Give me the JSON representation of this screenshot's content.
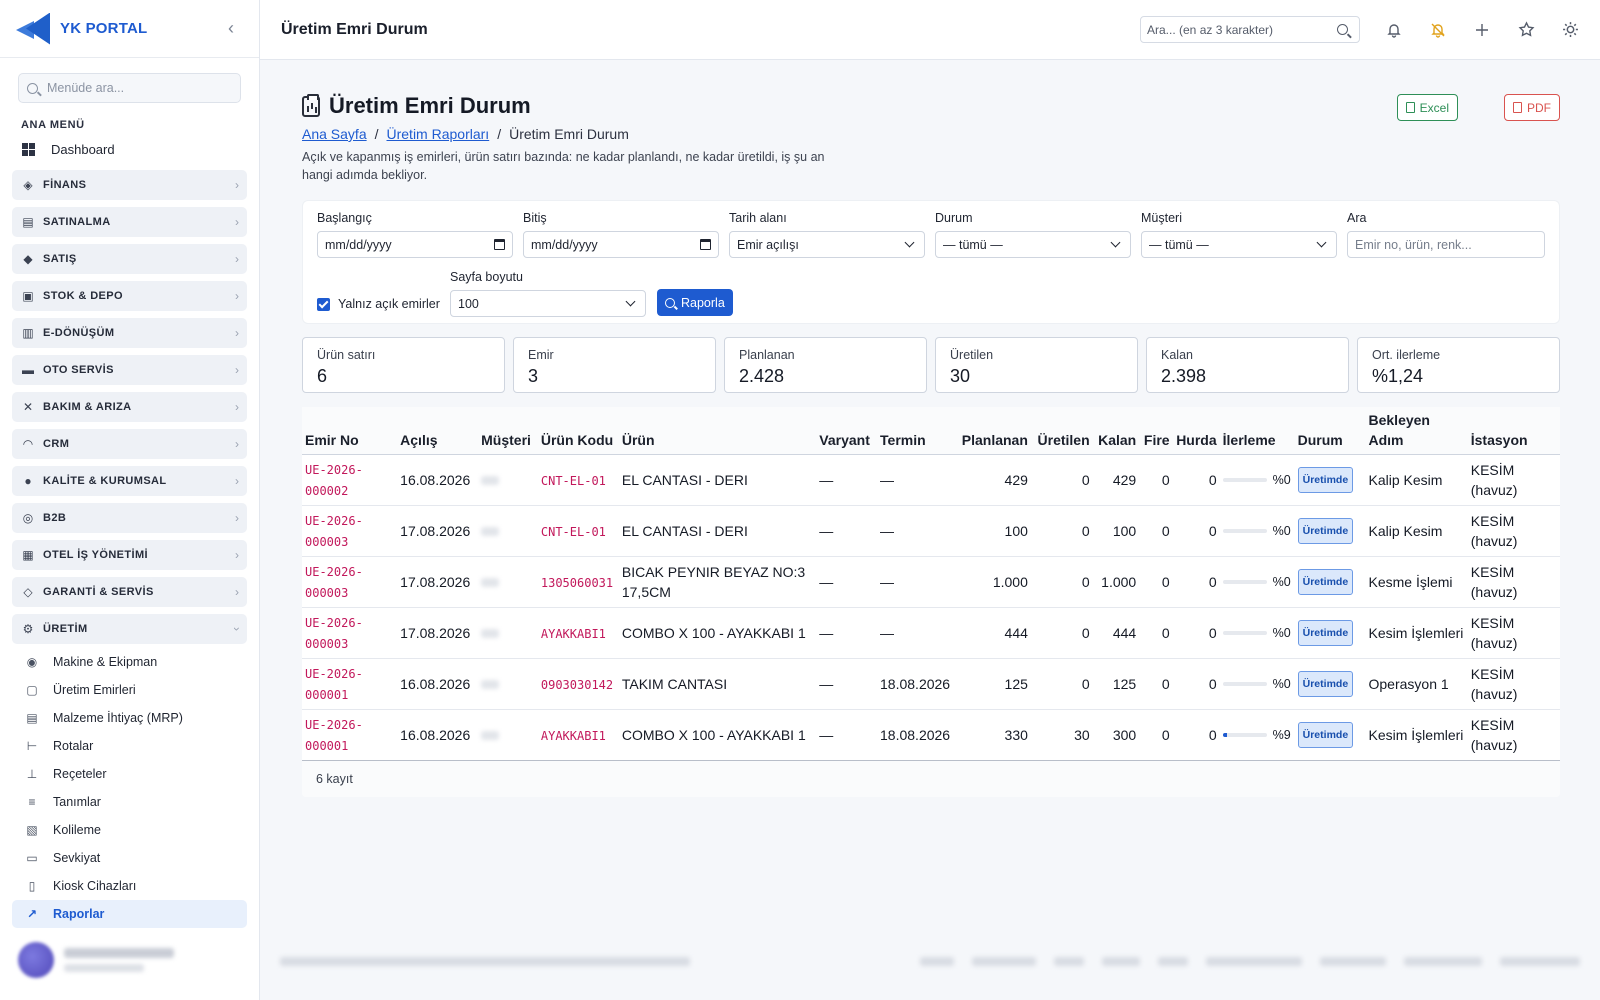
{
  "sidebar": {
    "brand": "YK PORTAL",
    "search_placeholder": "Menüde ara...",
    "menu_title": "ANA MENÜ",
    "dashboard": "Dashboard",
    "groups": [
      {
        "label": "FİNANS",
        "icon": "finance-icon"
      },
      {
        "label": "SATINALMA",
        "icon": "cart-icon"
      },
      {
        "label": "SATIŞ",
        "icon": "tag-icon"
      },
      {
        "label": "STOK & DEPO",
        "icon": "box-icon"
      },
      {
        "label": "E-DÖNÜŞÜM",
        "icon": "document-icon"
      },
      {
        "label": "OTO SERVİS",
        "icon": "car-icon"
      },
      {
        "label": "BAKIM & ARIZA",
        "icon": "tools-icon"
      },
      {
        "label": "CRM",
        "icon": "headset-icon"
      },
      {
        "label": "KALİTE & KURUMSAL",
        "icon": "badge-check-icon"
      },
      {
        "label": "B2B",
        "icon": "globe-icon"
      },
      {
        "label": "OTEL İŞ YÖNETİMİ",
        "icon": "building-icon"
      },
      {
        "label": "GARANTİ & SERVİS",
        "icon": "shield-icon"
      },
      {
        "label": "ÜRETİM",
        "icon": "gear-icon"
      }
    ],
    "production_items": [
      {
        "label": "Makine & Ekipman",
        "icon": "machine-icon"
      },
      {
        "label": "Üretim Emirleri",
        "icon": "clipboard-icon"
      },
      {
        "label": "Malzeme İhtiyaç (MRP)",
        "icon": "clipboard-list-icon"
      },
      {
        "label": "Rotalar",
        "icon": "signpost-icon"
      },
      {
        "label": "Reçeteler",
        "icon": "hierarchy-icon"
      },
      {
        "label": "Tanımlar",
        "icon": "sliders-icon"
      },
      {
        "label": "Kolileme",
        "icon": "package-icon"
      },
      {
        "label": "Sevkiyat",
        "icon": "truck-icon"
      },
      {
        "label": "Kiosk Cihazları",
        "icon": "tablet-icon"
      },
      {
        "label": "Raporlar",
        "icon": "chart-line-icon"
      }
    ]
  },
  "header": {
    "title": "Üretim Emri Durum",
    "search_placeholder": "Ara... (en az 3 karakter)"
  },
  "page": {
    "title": "Üretim Emri Durum",
    "breadcrumb": [
      "Ana Sayfa",
      "Üretim Raporları",
      "Üretim Emri Durum"
    ],
    "description": "Açık ve kapanmış iş emirleri, ürün satırı bazında: ne kadar planlandı, ne kadar üretildi, iş şu an hangi adımda bekliyor.",
    "excel_label": "Excel",
    "pdf_label": "PDF"
  },
  "filters": {
    "start_label": "Başlangıç",
    "start_value": "mm/dd/yyyy",
    "end_label": "Bitiş",
    "end_value": "mm/dd/yyyy",
    "date_field_label": "Tarih alanı",
    "date_field_value": "Emir açılışı",
    "status_label": "Durum",
    "status_value": "— tümü —",
    "customer_label": "Müşteri",
    "customer_value": "— tümü —",
    "search_label": "Ara",
    "search_placeholder": "Emir no, ürün, renk...",
    "open_only_label": "Yalnız açık emirler",
    "open_only_checked": true,
    "page_size_label": "Sayfa boyutu",
    "page_size_value": "100",
    "report_button": "Raporla"
  },
  "summary": [
    {
      "label": "Ürün satırı",
      "value": "6"
    },
    {
      "label": "Emir",
      "value": "3"
    },
    {
      "label": "Planlanan",
      "value": "2.428"
    },
    {
      "label": "Üretilen",
      "value": "30"
    },
    {
      "label": "Kalan",
      "value": "2.398"
    },
    {
      "label": "Ort. ilerleme",
      "value": "%1,24"
    }
  ],
  "table": {
    "headers": [
      "Emir No",
      "Açılış",
      "Müşteri",
      "Ürün Kodu",
      "Ürün",
      "Varyant",
      "Termin",
      "Planlanan",
      "Üretilen",
      "Kalan",
      "Fire",
      "Hurda",
      "İlerleme",
      "Durum",
      "Bekleyen Adım",
      "İstasyon"
    ],
    "rows": [
      {
        "emir_no": "UE-2026-000002",
        "acilis": "16.08.2026",
        "urun_kodu": "CNT-EL-01",
        "urun": "EL CANTASI - DERI",
        "varyant": "—",
        "termin": "—",
        "planlanan": "429",
        "uretilen": "0",
        "kalan": "429",
        "fire": "0",
        "hurda": "0",
        "ilerleme": 0,
        "ilerleme_label": "%0",
        "durum": "Üretimde",
        "bekleyen": "Kalip Kesim",
        "istasyon": "KESİM (havuz)"
      },
      {
        "emir_no": "UE-2026-000003",
        "acilis": "17.08.2026",
        "urun_kodu": "CNT-EL-01",
        "urun": "EL CANTASI - DERI",
        "varyant": "—",
        "termin": "—",
        "planlanan": "100",
        "uretilen": "0",
        "kalan": "100",
        "fire": "0",
        "hurda": "0",
        "ilerleme": 0,
        "ilerleme_label": "%0",
        "durum": "Üretimde",
        "bekleyen": "Kalip Kesim",
        "istasyon": "KESİM (havuz)"
      },
      {
        "emir_no": "UE-2026-000003",
        "acilis": "17.08.2026",
        "urun_kodu": "1305060031",
        "urun": "BICAK PEYNIR BEYAZ NO:3 17,5CM",
        "varyant": "—",
        "termin": "—",
        "planlanan": "1.000",
        "uretilen": "0",
        "kalan": "1.000",
        "fire": "0",
        "hurda": "0",
        "ilerleme": 0,
        "ilerleme_label": "%0",
        "durum": "Üretimde",
        "bekleyen": "Kesme İşlemi",
        "istasyon": "KESİM (havuz)"
      },
      {
        "emir_no": "UE-2026-000003",
        "acilis": "17.08.2026",
        "urun_kodu": "AYAKKABI1",
        "urun": "COMBO X 100 - AYAKKABI 1",
        "varyant": "—",
        "termin": "—",
        "planlanan": "444",
        "uretilen": "0",
        "kalan": "444",
        "fire": "0",
        "hurda": "0",
        "ilerleme": 0,
        "ilerleme_label": "%0",
        "durum": "Üretimde",
        "bekleyen": "Kesim İşlemleri",
        "istasyon": "KESİM (havuz)"
      },
      {
        "emir_no": "UE-2026-000001",
        "acilis": "16.08.2026",
        "urun_kodu": "0903030142",
        "urun": "TAKIM CANTASI",
        "varyant": "—",
        "termin": "18.08.2026",
        "planlanan": "125",
        "uretilen": "0",
        "kalan": "125",
        "fire": "0",
        "hurda": "0",
        "ilerleme": 0,
        "ilerleme_label": "%0",
        "durum": "Üretimde",
        "bekleyen": "Operasyon 1",
        "istasyon": "KESİM (havuz)"
      },
      {
        "emir_no": "UE-2026-000001",
        "acilis": "16.08.2026",
        "urun_kodu": "AYAKKABI1",
        "urun": "COMBO X 100 - AYAKKABI 1",
        "varyant": "—",
        "termin": "18.08.2026",
        "planlanan": "330",
        "uretilen": "30",
        "kalan": "300",
        "fire": "0",
        "hurda": "0",
        "ilerleme": 9,
        "ilerleme_label": "%9",
        "durum": "Üretimde",
        "bekleyen": "Kesim İşlemleri",
        "istasyon": "KESİM (havuz)"
      }
    ],
    "footer": "6 kayıt"
  },
  "colors": {
    "accent": "#1e5bd0",
    "excel": "#2e8f57",
    "pdf": "#d9534f",
    "code": "#c2185b",
    "warning_bell": "#e1a21b"
  }
}
